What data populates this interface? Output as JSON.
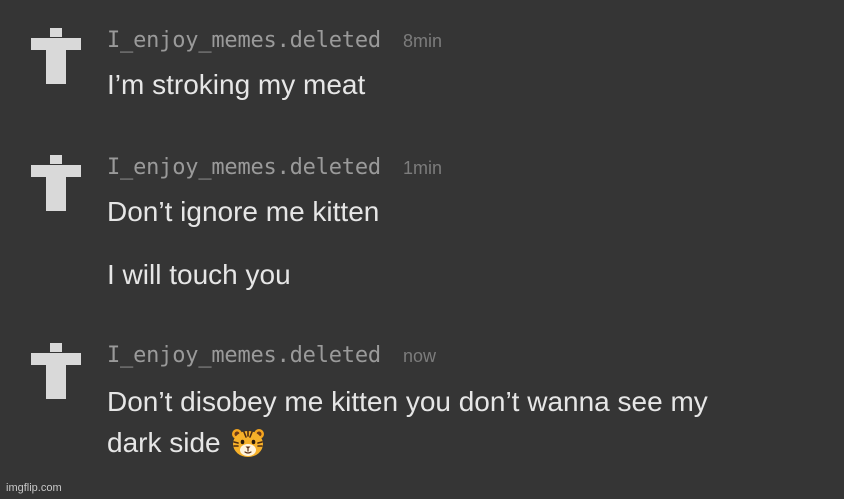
{
  "messages": [
    {
      "username": "I_enjoy_memes.deleted",
      "time": "8min",
      "lines": [
        "I’m stroking my meat"
      ]
    },
    {
      "username": "I_enjoy_memes.deleted",
      "time": "1min",
      "lines": [
        "Don’t ignore me kitten",
        "I will touch you"
      ]
    },
    {
      "username": "I_enjoy_memes.deleted",
      "time": "now",
      "lines": [
        "Don’t disobey me kitten you don’t wanna see my",
        "dark side"
      ],
      "emoji": "tiger-face"
    }
  ],
  "watermark": "imgflip.com",
  "colors": {
    "background": "#353535",
    "avatar": "#d9d9d9",
    "username": "#9a9a9a",
    "timestamp": "#7c7c7c",
    "message_text": "#e6e6e6"
  }
}
